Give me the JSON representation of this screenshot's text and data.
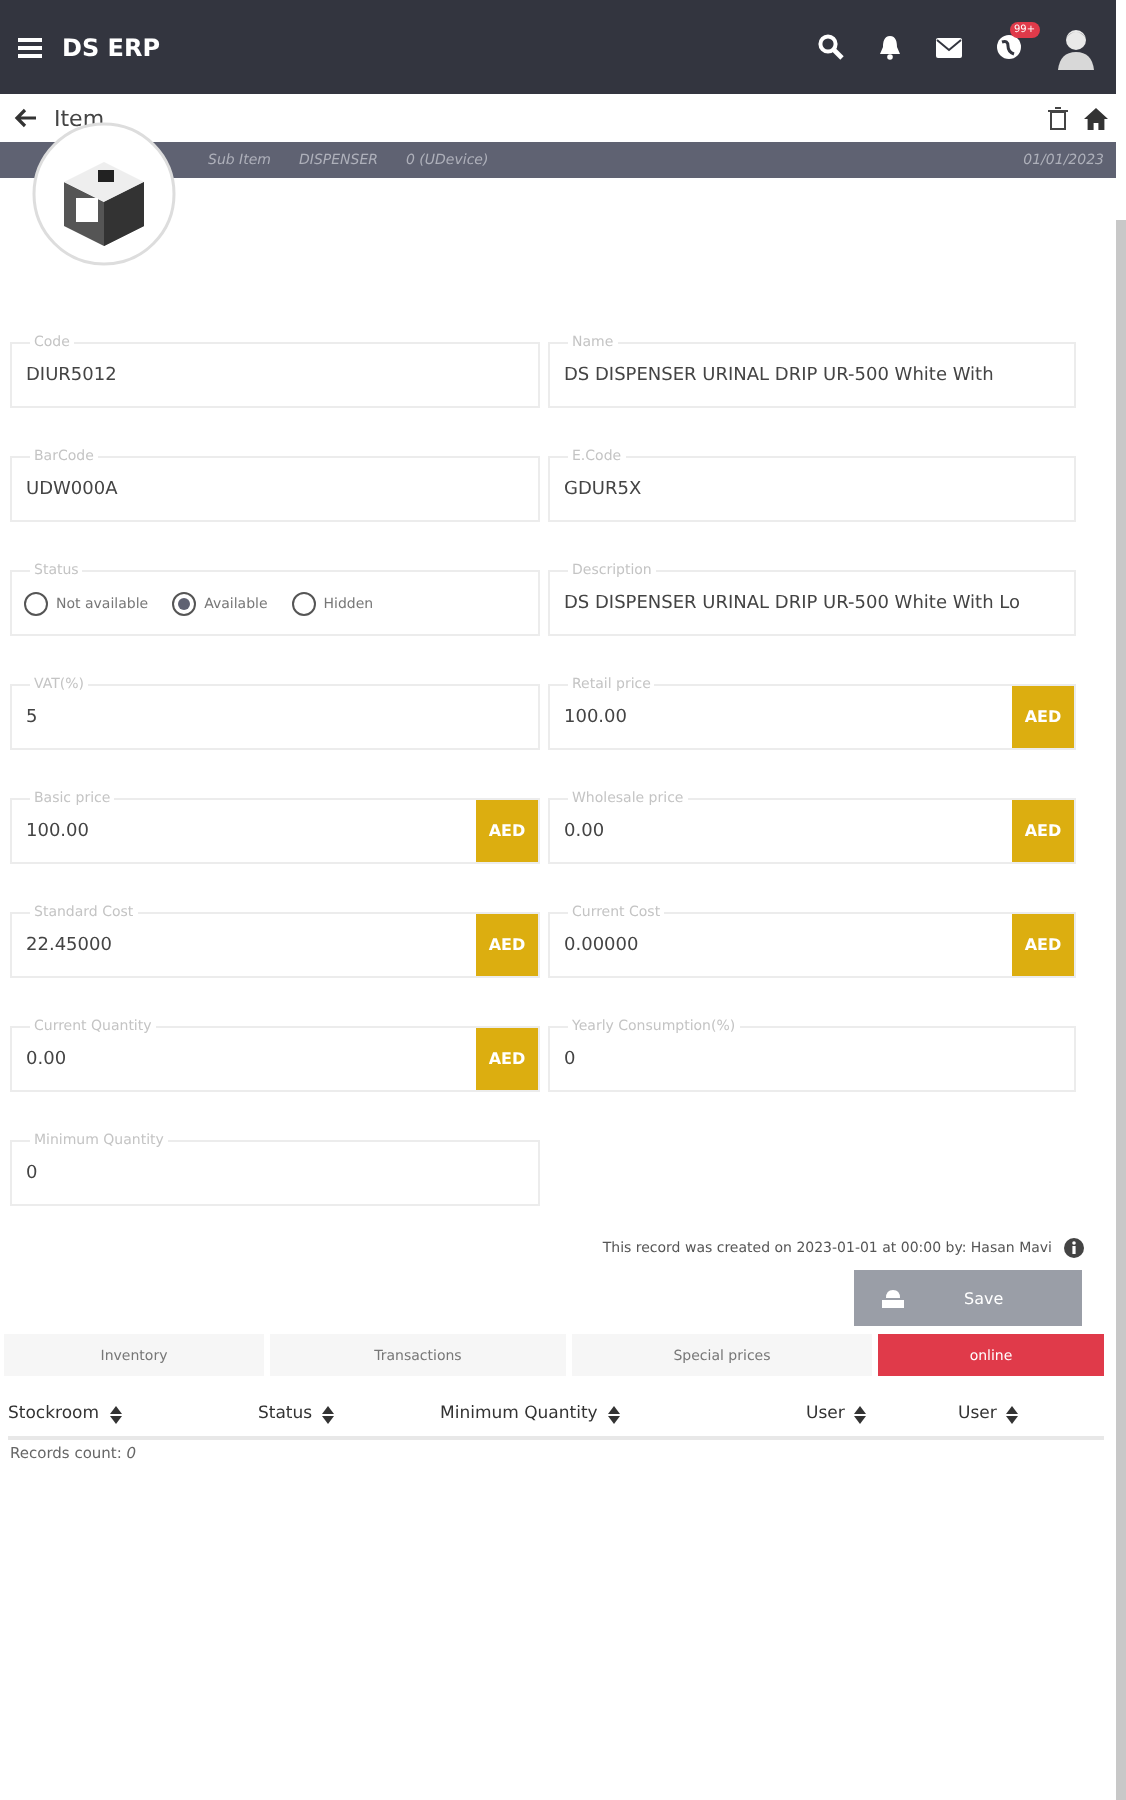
{
  "app_bar": {
    "title": "DS ERP",
    "notification_badge": "99+"
  },
  "page_bar": {
    "title": "Item"
  },
  "info_band": {
    "items": [
      "Sub Item",
      "DISPENSER",
      "0 (UDevice)"
    ],
    "date": "01/01/2023"
  },
  "fields": [
    {
      "kind": "text",
      "label": "Code",
      "value": "DIUR5012"
    },
    {
      "kind": "text",
      "label": "Name",
      "value": "DS DISPENSER URINAL DRIP UR-500 White With"
    },
    {
      "kind": "text",
      "label": "BarCode",
      "value": "UDW000A"
    },
    {
      "kind": "text",
      "label": "E.Code",
      "value": "GDUR5X"
    },
    {
      "kind": "radio",
      "label": "Status",
      "options": [
        {
          "label": "Not available",
          "selected": false
        },
        {
          "label": "Available",
          "selected": true
        },
        {
          "label": "Hidden",
          "selected": false
        }
      ]
    },
    {
      "kind": "text",
      "label": "Description",
      "value": "DS DISPENSER URINAL DRIP UR-500 White With Lo"
    },
    {
      "kind": "text",
      "label": "VAT(%)",
      "value": "5"
    },
    {
      "kind": "currency",
      "label": "Retail price",
      "value": "100.00",
      "currency": "AED"
    },
    {
      "kind": "currency",
      "label": "Basic price",
      "value": "100.00",
      "currency": "AED"
    },
    {
      "kind": "currency",
      "label": "Wholesale price",
      "value": "0.00",
      "currency": "AED"
    },
    {
      "kind": "currency",
      "label": "Standard Cost",
      "value": "22.45000",
      "currency": "AED"
    },
    {
      "kind": "currency",
      "label": "Current Cost",
      "value": "0.00000",
      "currency": "AED"
    },
    {
      "kind": "currency",
      "label": "Current Quantity",
      "value": "0.00",
      "currency": "AED"
    },
    {
      "kind": "text",
      "label": "Yearly Consumption(%)",
      "value": "0"
    },
    {
      "kind": "text",
      "label": "Minimum Quantity",
      "value": "0"
    }
  ],
  "record_note": "This record was created on 2023-01-01 at 00:00 by: Hasan Mavi",
  "save_button": {
    "label": "Save",
    "disabled": true
  },
  "tabs": [
    {
      "label": "Inventory",
      "selected": false
    },
    {
      "label": "Transactions",
      "selected": false
    },
    {
      "label": "Special prices",
      "selected": false
    },
    {
      "label": "online",
      "selected": true
    }
  ],
  "table": {
    "columns": [
      "Stockroom",
      "Status",
      "Minimum Quantity",
      "User",
      "User"
    ]
  },
  "records_count": "Records count: *0*"
}
